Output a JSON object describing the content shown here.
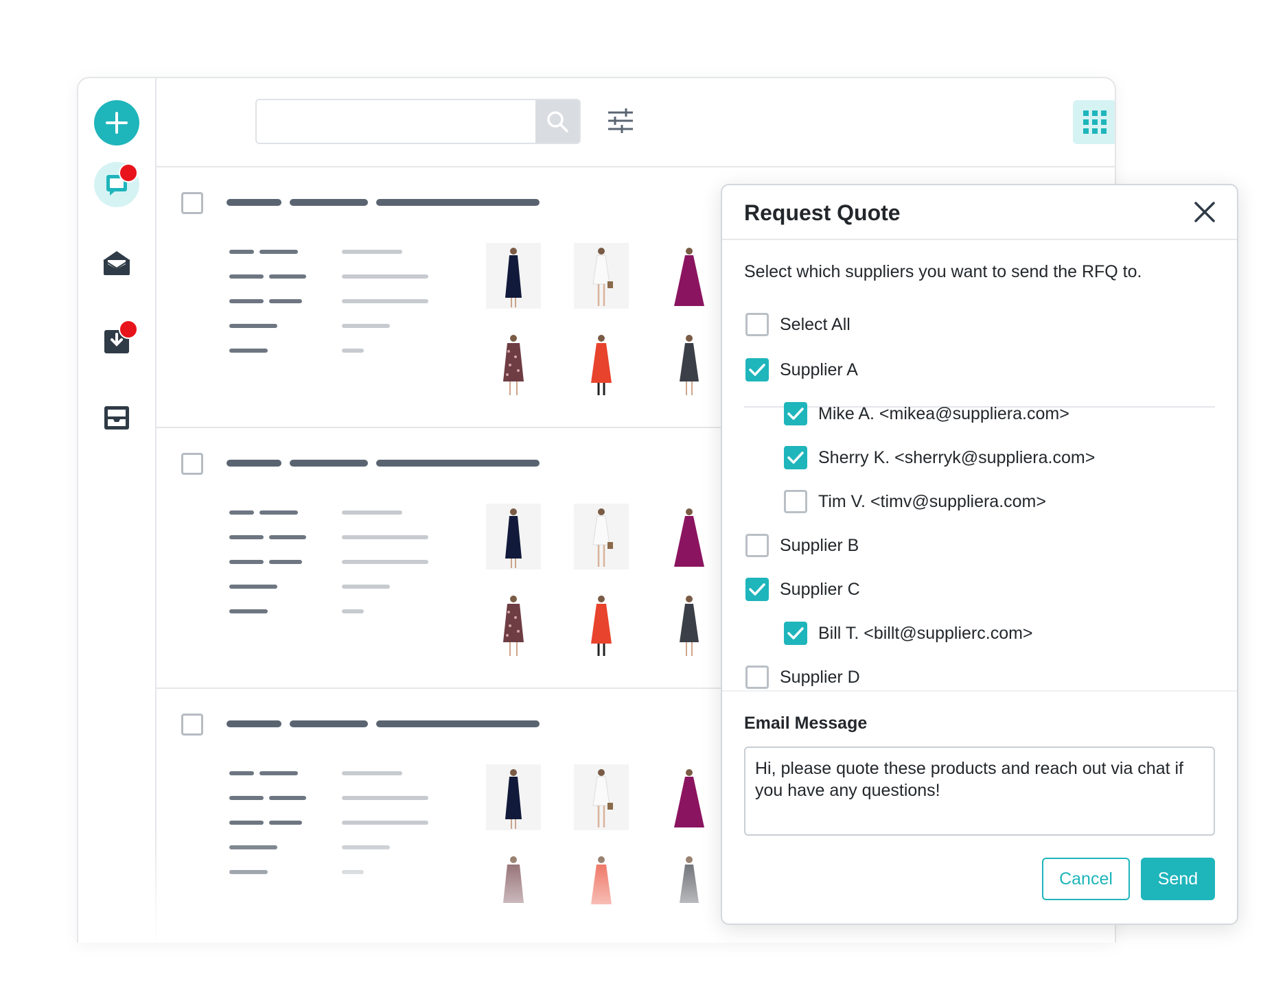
{
  "toolbar": {
    "search_placeholder": "",
    "icons": [
      "plus-icon",
      "chat-icon",
      "envelope-open-icon",
      "download-box-icon",
      "inbox-icon",
      "search-icon",
      "sliders-icon",
      "grid-view-icon",
      "list-view-icon"
    ]
  },
  "colors": {
    "accent": "#1eb5bb",
    "accent_light": "#d6f3f4",
    "badge": "#e8141b"
  },
  "dialog": {
    "title": "Request Quote",
    "intro": "Select which suppliers you want to send the RFQ to.",
    "select_all": {
      "label": "Select All",
      "checked": false
    },
    "suppliers": [
      {
        "label": "Supplier A",
        "checked": true,
        "contacts": [
          {
            "label": "Mike A. <mikea@suppliera.com>",
            "checked": true
          },
          {
            "label": "Sherry K. <sherryk@suppliera.com>",
            "checked": true
          },
          {
            "label": "Tim V. <timv@suppliera.com>",
            "checked": false
          }
        ]
      },
      {
        "label": "Supplier B",
        "checked": false,
        "contacts": []
      },
      {
        "label": "Supplier C",
        "checked": true,
        "contacts": [
          {
            "label": "Bill T. <billt@supplierc.com>",
            "checked": true
          }
        ]
      },
      {
        "label": "Supplier D",
        "checked": false,
        "contacts": []
      }
    ],
    "email_label": "Email Message",
    "email_value": "Hi, please quote these products and reach out via chat if you have any questions!",
    "cancel_label": "Cancel",
    "send_label": "Send"
  }
}
